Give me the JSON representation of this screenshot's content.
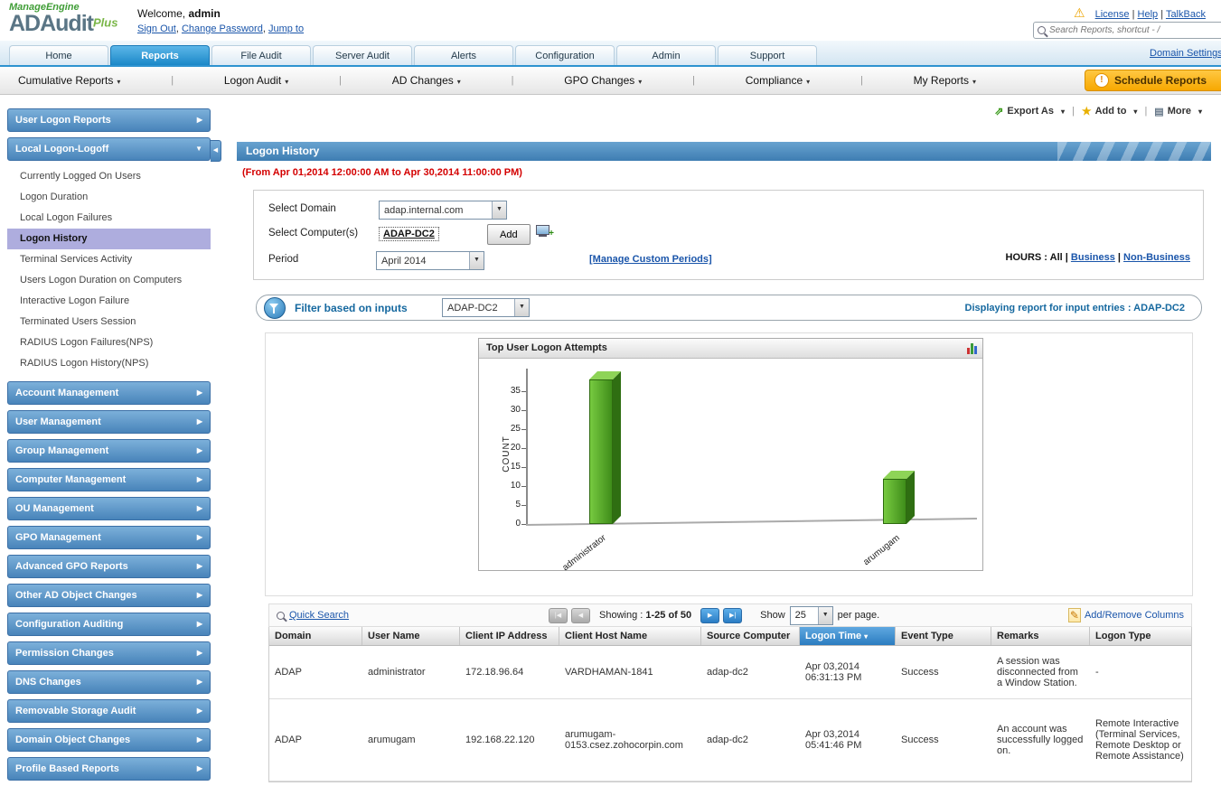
{
  "ui": {
    "pipe": "|",
    "comma": ","
  },
  "icons": {
    "first": "|◀",
    "prev": "◀",
    "next": "▶",
    "last": "▶|",
    "caret_down": "▾",
    "arrow_right": "▶",
    "arrow_down": "▼",
    "warning": "⚠",
    "export": "⇗",
    "star": "★",
    "more": "▤",
    "pencil": "✎",
    "collapse": "◀",
    "sort_desc": "▾",
    "sched": "!"
  },
  "header": {
    "brand": "ManageEngine",
    "product": "ADAudit",
    "product_suffix": "Plus",
    "welcome_label": "Welcome,",
    "welcome_user": "admin",
    "sign_out": "Sign Out",
    "change_password": "Change Password",
    "jump_to": "Jump to",
    "license": "License",
    "help": "Help",
    "talkback": "TalkBack",
    "search_placeholder": "Search Reports, shortcut - /"
  },
  "tabs": {
    "items": [
      "Home",
      "Reports",
      "File Audit",
      "Server Audit",
      "Alerts",
      "Configuration",
      "Admin",
      "Support"
    ],
    "active": "Reports",
    "domain_settings": "Domain Settings"
  },
  "subnav": {
    "items": [
      "Cumulative Reports",
      "Logon Audit",
      "AD Changes",
      "GPO Changes",
      "Compliance",
      "My Reports"
    ],
    "schedule_reports": "Schedule Reports"
  },
  "sidebar": {
    "top_sections": [
      {
        "label": "User Logon Reports",
        "expanded": false
      },
      {
        "label": "Local Logon-Logoff",
        "expanded": true
      }
    ],
    "local_logon_items": [
      {
        "label": "Currently Logged On Users",
        "selected": false
      },
      {
        "label": "Logon Duration",
        "selected": false
      },
      {
        "label": "Local Logon Failures",
        "selected": false
      },
      {
        "label": "Logon History",
        "selected": true
      },
      {
        "label": "Terminal Services Activity",
        "selected": false
      },
      {
        "label": "Users Logon Duration on Computers",
        "selected": false
      },
      {
        "label": "Interactive Logon Failure",
        "selected": false
      },
      {
        "label": "Terminated Users Session",
        "selected": false
      },
      {
        "label": "RADIUS Logon Failures(NPS)",
        "selected": false
      },
      {
        "label": "RADIUS Logon History(NPS)",
        "selected": false
      }
    ],
    "bottom_sections": [
      "Account Management",
      "User Management",
      "Group Management",
      "Computer Management",
      "OU Management",
      "GPO Management",
      "Advanced GPO Reports",
      "Other AD Object Changes",
      "Configuration Auditing",
      "Permission Changes",
      "DNS Changes",
      "Removable Storage Audit",
      "Domain Object Changes",
      "Profile Based Reports"
    ]
  },
  "actions": {
    "export_as": "Export As",
    "add_to": "Add to",
    "more": "More"
  },
  "report": {
    "title": "Logon History",
    "date_range": "(From Apr 01,2014 12:00:00 AM to Apr 30,2014 11:00:00 PM)",
    "form": {
      "select_domain_label": "Select Domain",
      "select_domain_value": "adap.internal.com",
      "select_computers_label": "Select Computer(s)",
      "select_computers_value": "ADAP-DC2",
      "add_button": "Add",
      "period_label": "Period",
      "period_value": "April 2014",
      "manage_custom_periods": "[Manage Custom Periods]",
      "hours_label": "HOURS :",
      "hours_all": "All",
      "hours_business": "Business",
      "hours_non_business": "Non-Business"
    },
    "filter": {
      "label": "Filter based on inputs",
      "value": "ADAP-DC2",
      "displaying_label": "Displaying report for input entries :",
      "displaying_value": "ADAP-DC2"
    }
  },
  "chart_data": {
    "type": "bar",
    "title": "Top User Logon Attempts",
    "categories": [
      "administrator",
      "arumugam"
    ],
    "values": [
      38,
      12
    ],
    "xlabel": "",
    "ylabel": "COUNT",
    "ylim": [
      0,
      40
    ],
    "yticks": [
      0,
      5,
      10,
      15,
      20,
      25,
      30,
      35
    ],
    "bar_color": "#4ca32a",
    "grid": false,
    "legend": false
  },
  "table": {
    "quick_search": "Quick Search",
    "showing_label": "Showing :",
    "showing_range": "1-25 of 50",
    "show_label": "Show",
    "page_size": "25",
    "per_page": "per page.",
    "add_remove_columns": "Add/Remove Columns",
    "sorted_column": "Logon Time",
    "columns": [
      "Domain",
      "User Name",
      "Client IP Address",
      "Client Host Name",
      "Source Computer",
      "Logon Time",
      "Event Type",
      "Remarks",
      "Logon Type"
    ],
    "rows": [
      [
        "ADAP",
        "administrator",
        "172.18.96.64",
        "VARDHAMAN-1841",
        "adap-dc2",
        "Apr 03,2014 06:31:13 PM",
        "Success",
        "A session was disconnected from a Window Station.",
        "-"
      ],
      [
        "ADAP",
        "arumugam",
        "192.168.22.120",
        "arumugam-0153.csez.zohocorpin.com",
        "adap-dc2",
        "Apr 03,2014 05:41:46 PM",
        "Success",
        "An account was successfully logged on.",
        "Remote Interactive (Terminal Services, Remote Desktop or Remote Assistance)"
      ]
    ]
  }
}
